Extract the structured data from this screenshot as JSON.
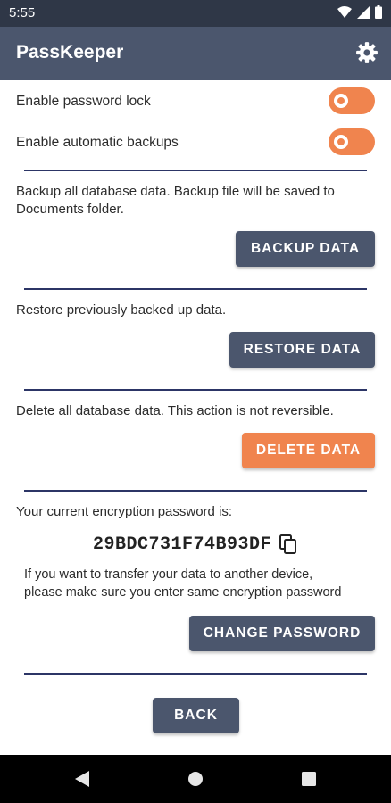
{
  "status_bar": {
    "time": "5:55"
  },
  "app_bar": {
    "title": "PassKeeper",
    "settings_icon": "gear-icon"
  },
  "settings": {
    "password_lock_label": "Enable password lock",
    "auto_backup_label": "Enable automatic backups",
    "password_lock_enabled": true,
    "auto_backup_enabled": true
  },
  "backup": {
    "description_line1": "Backup all database data. Backup file will be saved to",
    "description_line2": "Documents folder.",
    "button_label": "BACKUP DATA"
  },
  "restore": {
    "description": "Restore previously backed up data.",
    "button_label": "RESTORE DATA"
  },
  "delete": {
    "description": "Delete all database data. This action is not reversible.",
    "button_label": "DELETE DATA"
  },
  "encryption": {
    "label": "Your current encryption password is:",
    "password": "29BDC731F74B93DF",
    "note_line1": "If you want to transfer your data to another device,",
    "note_line2": "please make sure you enter same encryption password",
    "button_label": "CHANGE PASSWORD"
  },
  "footer": {
    "back_label": "BACK"
  },
  "colors": {
    "primary": "#4b566d",
    "accent": "#f0844e",
    "divider": "#2c3566"
  }
}
